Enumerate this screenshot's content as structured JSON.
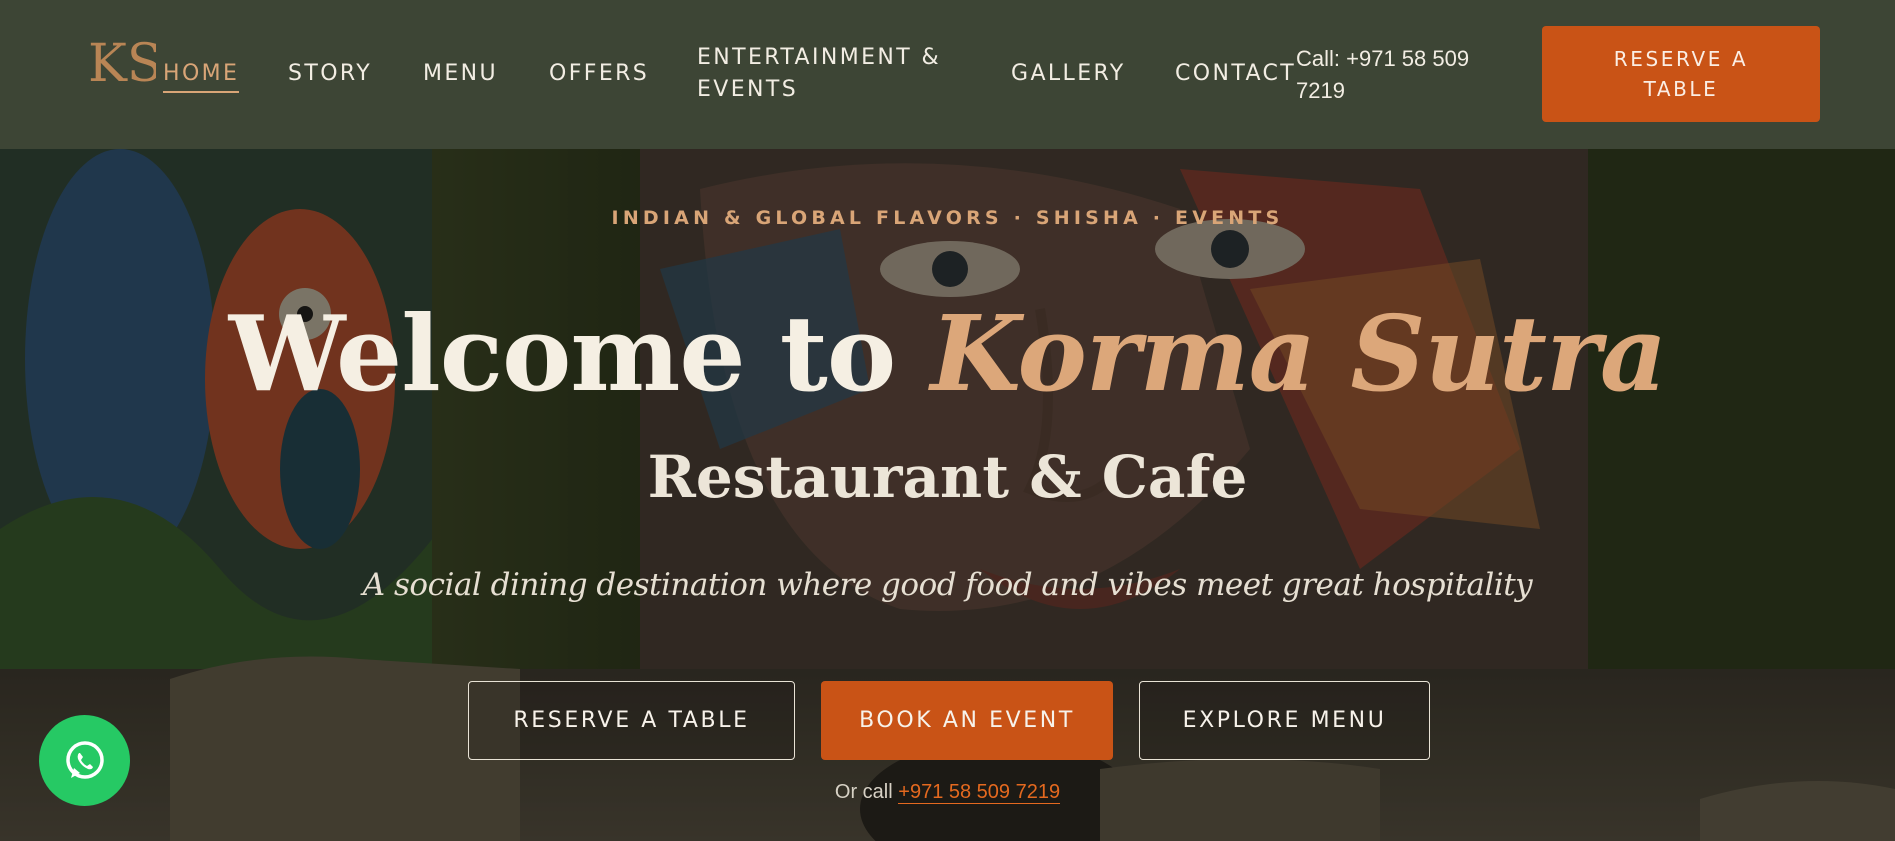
{
  "header": {
    "logo_text": "KS",
    "nav": [
      {
        "label": "HOME",
        "active": true
      },
      {
        "label": "STORY"
      },
      {
        "label": "MENU"
      },
      {
        "label": "OFFERS"
      },
      {
        "label": "ENTERTAINMENT & EVENTS"
      },
      {
        "label": "GALLERY"
      },
      {
        "label": "CONTACT"
      }
    ],
    "call": "Call: +971 58 509 7219",
    "cta": "RESERVE A TABLE"
  },
  "hero": {
    "eyebrow": "INDIAN & GLOBAL FLAVORS · SHISHA · EVENTS",
    "title_prefix": "Welcome to",
    "title_brand": "Korma Sutra",
    "subtitle": "Restaurant & Cafe",
    "tagline": "A social dining destination where good food and vibes meet great hospitality",
    "buttons": {
      "reserve": "RESERVE A TABLE",
      "book": "BOOK AN EVENT",
      "explore": "EXPLORE MENU"
    },
    "or_call_label": "Or call",
    "or_call_number": "+971 58 509 7219"
  },
  "floating": {
    "whatsapp_icon": "whatsapp-icon"
  },
  "colors": {
    "header_bg": "#3d4535",
    "accent_orange": "#c95316",
    "accent_gold": "#d9a577",
    "whatsapp_green": "#26c964"
  }
}
